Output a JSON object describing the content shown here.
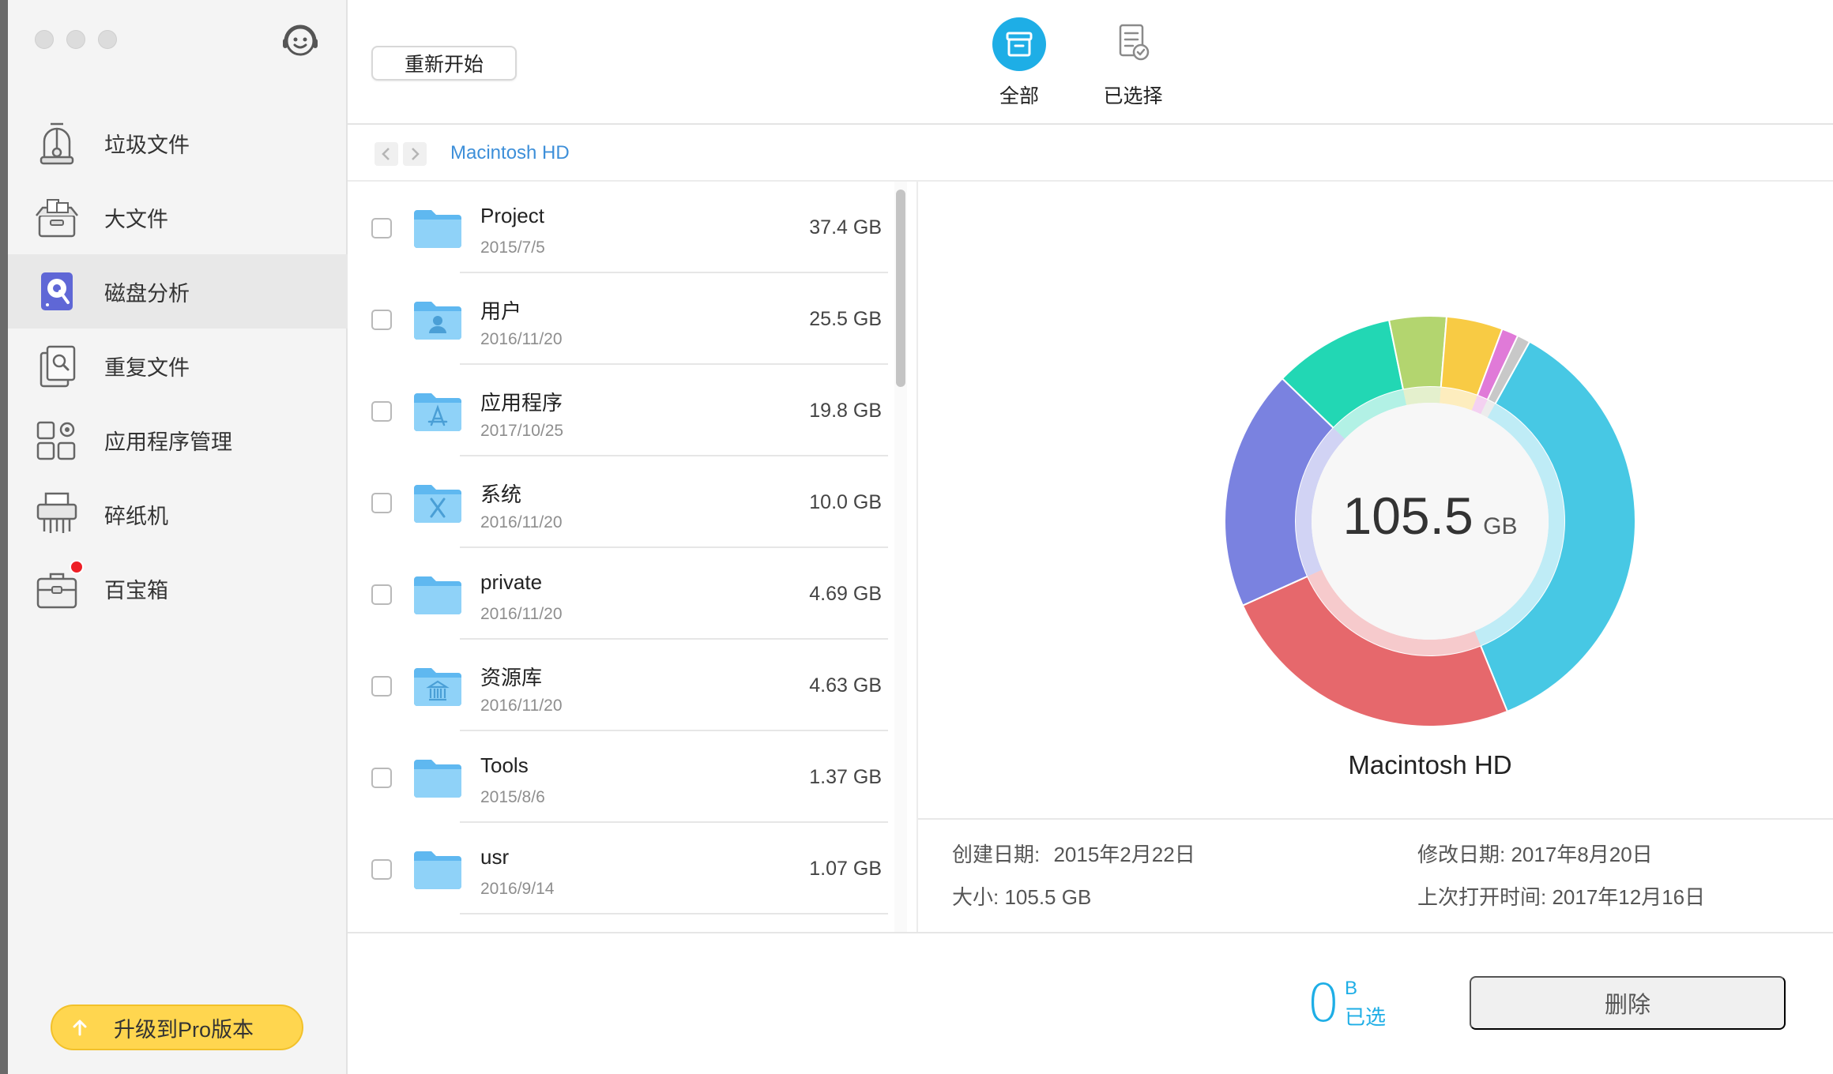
{
  "sidebar": {
    "items": [
      {
        "label": "垃圾文件",
        "icon": "vacuum-cleaner-icon"
      },
      {
        "label": "大文件",
        "icon": "large-file-box-icon"
      },
      {
        "label": "磁盘分析",
        "icon": "disk-analysis-icon",
        "active": true
      },
      {
        "label": "重复文件",
        "icon": "duplicate-file-icon"
      },
      {
        "label": "应用程序管理",
        "icon": "app-manager-icon"
      },
      {
        "label": "碎纸机",
        "icon": "shredder-icon"
      },
      {
        "label": "百宝箱",
        "icon": "toolbox-icon",
        "badge": true
      }
    ],
    "upgrade_label": "升级到Pro版本"
  },
  "toolbar": {
    "restart_label": "重新开始",
    "tab_all": "全部",
    "tab_selected": "已选择"
  },
  "breadcrumb": {
    "current": "Macintosh HD"
  },
  "files": [
    {
      "name": "Project",
      "date": "2015/7/5",
      "size": "37.4 GB",
      "icon": "folder-icon"
    },
    {
      "name": "用户",
      "date": "2016/11/20",
      "size": "25.5 GB",
      "icon": "users-folder-icon"
    },
    {
      "name": "应用程序",
      "date": "2017/10/25",
      "size": "19.8 GB",
      "icon": "applications-folder-icon"
    },
    {
      "name": "系统",
      "date": "2016/11/20",
      "size": "10.0 GB",
      "icon": "system-folder-icon"
    },
    {
      "name": "private",
      "date": "2016/11/20",
      "size": "4.69 GB",
      "icon": "folder-icon"
    },
    {
      "name": "资源库",
      "date": "2016/11/20",
      "size": "4.63 GB",
      "icon": "library-folder-icon"
    },
    {
      "name": "Tools",
      "date": "2015/8/6",
      "size": "1.37 GB",
      "icon": "folder-icon"
    },
    {
      "name": "usr",
      "date": "2016/9/14",
      "size": "1.07 GB",
      "icon": "folder-icon"
    }
  ],
  "detail": {
    "total_value": "105.5",
    "total_unit": "GB",
    "name": "Macintosh HD",
    "created_label": "创建日期:",
    "created_value": "2015年2月22日",
    "modified": "修改日期: 2017年8月20日",
    "size": "大小: 105.5 GB",
    "last_opened": "上次打开时间: 2017年12月16日"
  },
  "selection": {
    "count": "0",
    "unit": "B",
    "label": "已选",
    "delete_label": "删除"
  },
  "colors": {
    "accent": "#1eaee6",
    "link": "#3d8fd9",
    "upgrade": "#ffd64f",
    "badge": "#ee1f26"
  },
  "chart_data": {
    "type": "pie",
    "segments": [
      {
        "value": 37.4,
        "color": "#47c8e4"
      },
      {
        "value": 25.5,
        "color": "#e6686c"
      },
      {
        "value": 19.8,
        "color": "#7a82e0"
      },
      {
        "value": 10.0,
        "color": "#22d7b4"
      },
      {
        "value": 4.69,
        "color": "#b3d56f"
      },
      {
        "value": 4.63,
        "color": "#f8cb44"
      },
      {
        "value": 1.37,
        "color": "#e07ad8"
      },
      {
        "value": 1.07,
        "color": "#c8c8c8"
      }
    ],
    "total": 105.5
  }
}
